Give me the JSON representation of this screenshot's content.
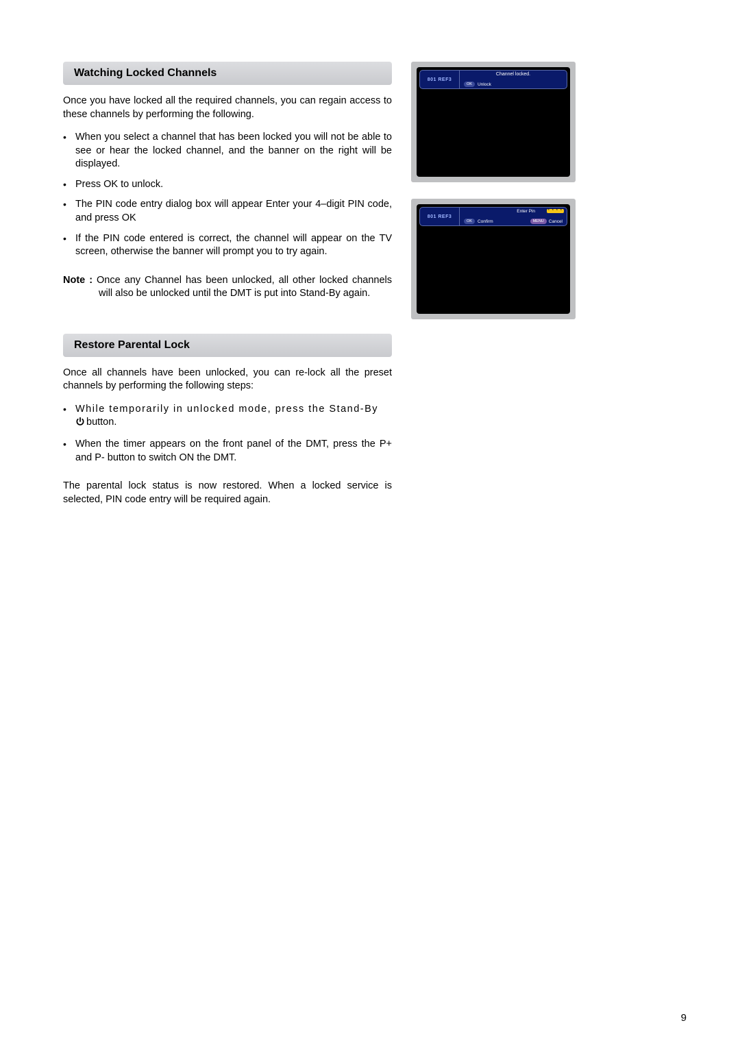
{
  "page_number": "9",
  "section1": {
    "title": "Watching Locked Channels",
    "intro": "Once you have locked all the required channels, you can regain access to these channels by performing the following.",
    "bullets": [
      "When you select a channel that has been locked you will not be able to see or hear the locked channel, and the banner on the right will be displayed.",
      "Press OK to unlock.",
      "The PIN code entry dialog box will appear Enter your 4–digit PIN code, and press OK",
      "If the PIN code entered is correct, the channel will appear on the TV screen, otherwise the banner will prompt you to try again."
    ],
    "note_label": "Note :",
    "note_text": "Once any Channel has been unlocked, all other locked channels will also be unlocked until the DMT is put into Stand-By again."
  },
  "section2": {
    "title": "Restore Parental Lock",
    "intro": "Once all channels have been unlocked, you can re-lock all the preset channels by performing the following steps:",
    "bullet1_pre": "While temporarily in unlocked mode, press the Stand-By",
    "bullet1_post": "button.",
    "bullet2": "When the timer appears on the front panel of the DMT, press the P+ and P- button to switch ON the DMT.",
    "closing": "The parental lock status is now restored. When a locked service is selected, PIN code entry will be required again."
  },
  "tv1": {
    "channel": "801  REF3",
    "status": "Channel locked.",
    "ok_label": "OK",
    "unlock_label": "Unlock"
  },
  "tv2": {
    "channel": "801  REF3",
    "enter_pin_label": "Enter Pin",
    "pin_mask": "* * * *",
    "ok_label": "OK",
    "confirm_label": "Confirm",
    "menu_label": "MENU",
    "cancel_label": "Cancel"
  }
}
